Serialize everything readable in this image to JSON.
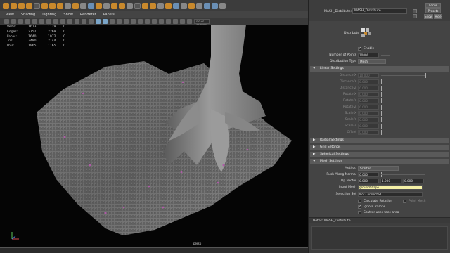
{
  "viewport_menu": [
    "View",
    "Shading",
    "Lighting",
    "Show",
    "Renderer",
    "Panels"
  ],
  "viewport_toolbar": {
    "color_space": "sRGB gamma"
  },
  "hud": {
    "rows": [
      {
        "label": "Verts:",
        "v1": "1613",
        "v2": "1129",
        "v3": "0"
      },
      {
        "label": "Edges:",
        "v1": "2752",
        "v2": "2269",
        "v3": "0"
      },
      {
        "label": "Faces:",
        "v1": "1640",
        "v2": "1072",
        "v3": "0"
      },
      {
        "label": "Tris:",
        "v1": "3490",
        "v2": "2144",
        "v3": "0"
      },
      {
        "label": "UVs:",
        "v1": "1965",
        "v2": "1165",
        "v3": "0"
      }
    ]
  },
  "camera_label": "persp",
  "colors": {
    "accent_orange": "#c9892c",
    "input_highlight": "#f4f0a6",
    "section_header": "#5a5a5a"
  },
  "attribute_editor": {
    "node_label": "MASH_Distribute:",
    "node_name": "MASH_Distribute",
    "focus_label": "Focus",
    "presets_label": "Presets",
    "show_label": "Show",
    "hide_label": "Hide",
    "distribute_title": "Distribute",
    "enable_label": "Enable",
    "num_points_label": "Number of Points",
    "num_points_value": "10000",
    "dist_type_label": "Distribution Type",
    "dist_type_value": "Mesh",
    "linear_section": "Linear Settings",
    "linear_fields": [
      {
        "label": "Distance X",
        "value": "10.000"
      },
      {
        "label": "Distance Y",
        "value": "0.000"
      },
      {
        "label": "Distance Z",
        "value": "0.000"
      },
      {
        "label": "Rotate X",
        "value": "0.000"
      },
      {
        "label": "Rotate Y",
        "value": "0.000"
      },
      {
        "label": "Rotate Z",
        "value": "0.000"
      },
      {
        "label": "Scale X",
        "value": "0.000"
      },
      {
        "label": "Scale Y",
        "value": "0.000"
      },
      {
        "label": "Scale Z",
        "value": "0.000"
      },
      {
        "label": "Offset",
        "value": "0.000"
      }
    ],
    "collapsed_sections": [
      "Radial Settings",
      "Grid Settings",
      "Spherical Settings"
    ],
    "mesh_section": "Mesh Settings",
    "method_label": "Method",
    "method_value": "Scatter",
    "push_label": "Push Along Normal",
    "push_value": "0.000",
    "up_label": "Up Vector",
    "up_values": [
      "0.000",
      "1.000",
      "0.000"
    ],
    "input_mesh_label": "Input Mesh",
    "input_mesh_value": "groundShape",
    "selection_set_label": "Selection Set",
    "selection_set_value": "Not Connected",
    "checks": [
      {
        "label": "Calculate Rotation",
        "checked": false
      },
      {
        "label": "Ignore Ramps",
        "checked": true
      },
      {
        "label": "Scatter uses face area",
        "checked": false
      }
    ],
    "point_mesh_label": "Point Mesh",
    "notes_label": "Notes: MASH_Distribute"
  }
}
